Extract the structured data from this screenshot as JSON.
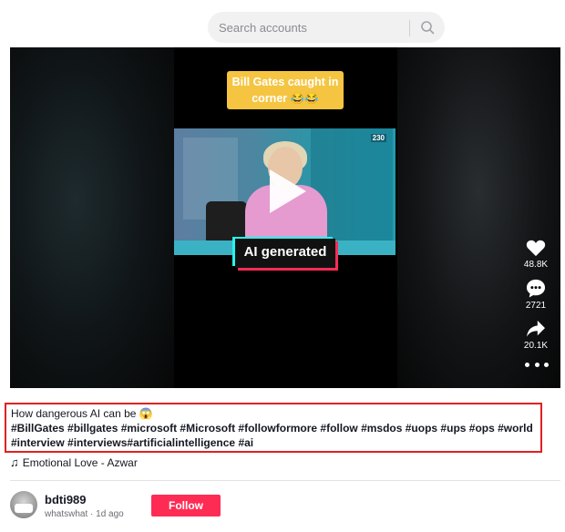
{
  "search": {
    "placeholder": "Search accounts",
    "icon": "search-icon"
  },
  "video": {
    "caption_sticker": "Bill Gates caught in corner 😂😂",
    "channel_logo": "230",
    "ai_badge": "AI generated"
  },
  "actions": {
    "likes": "48.8K",
    "comments": "2721",
    "shares": "20.1K"
  },
  "description": {
    "text": "How dangerous AI can be 😱",
    "hashtags": "#BillGates #billgates #microsoft #Microsoft #followformore #follow #msdos #uops #ups #ops #world #interview #interviews#artificialintelligence #ai"
  },
  "music": {
    "title": "Emotional Love - Azwar"
  },
  "author": {
    "username": "bdti989",
    "meta": "whatswhat · 1d ago",
    "follow_label": "Follow"
  },
  "colors": {
    "accent": "#fe2c55",
    "highlight_border": "#e02020",
    "sticker": "#f5c542"
  }
}
